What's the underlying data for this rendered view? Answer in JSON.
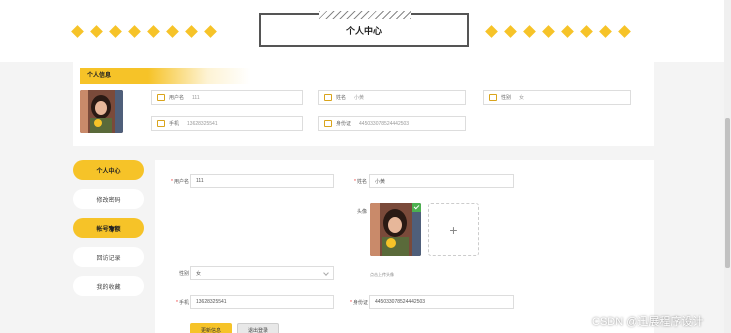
{
  "header": {
    "title": "个人中心"
  },
  "profile": {
    "section_label": "个人信息",
    "fields": [
      {
        "icon": "id-card-icon",
        "label": "用户名",
        "value": "111"
      },
      {
        "icon": "calendar-icon",
        "label": "姓名",
        "value": "小黄"
      },
      {
        "icon": "home-icon",
        "label": "性别",
        "value": "女"
      },
      {
        "icon": "phone-icon",
        "label": "手机",
        "value": "13628325541"
      },
      {
        "icon": "lock-icon",
        "label": "身份证",
        "value": "445033078524442503"
      }
    ]
  },
  "sidebar": {
    "items": [
      {
        "label": "个人中心",
        "active": true
      },
      {
        "label": "修改密码",
        "active": false
      },
      {
        "label": "帐号余额",
        "active": true
      },
      {
        "label": "回访记录",
        "active": false
      },
      {
        "label": "我的收藏",
        "active": false
      }
    ]
  },
  "form": {
    "username": {
      "label": "用户名",
      "value": "111"
    },
    "name": {
      "label": "姓名",
      "value": "小黄"
    },
    "avatar_label": "头像",
    "upload_hint": "点击上传头像",
    "gender": {
      "label": "性别",
      "value": "女"
    },
    "phone": {
      "label": "手机",
      "value": "13628325541"
    },
    "id_card": {
      "label": "身份证",
      "value": "445033078524442503"
    },
    "submit_label": "更新信息",
    "logout_label": "退出登录"
  },
  "watermark": "CSDN @迅展程序设计",
  "colors": {
    "accent": "#f6c328",
    "background": "#f4f4f4"
  }
}
